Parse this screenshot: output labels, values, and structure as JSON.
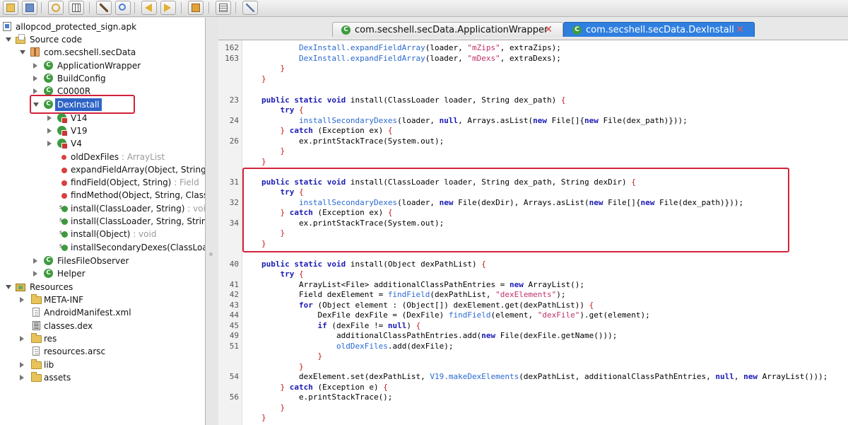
{
  "toolbar": {
    "buttons": [
      "open-icon",
      "save-all-icon",
      "sync-icon",
      "unflatten-icon",
      "wand-icon",
      "search-icon",
      "back-icon",
      "forward-icon",
      "bookmark-icon",
      "log-icon",
      "preferences-icon"
    ]
  },
  "tree": {
    "apk": "allopcod_protected_sign.apk",
    "source_code": "Source code",
    "package": "com.secshell.secData",
    "classes": [
      "ApplicationWrapper",
      "BuildConfig",
      "C0000R"
    ],
    "selected_class": "DexInstall",
    "inner": [
      "V14",
      "V19",
      "V4"
    ],
    "fields": [
      {
        "name": "oldDexFiles",
        "type": " : ArrayList"
      }
    ],
    "methods": [
      {
        "name": "expandFieldArray(Object, String, O",
        "type": ""
      },
      {
        "name": "findField(Object, String)",
        "type": " : Field"
      },
      {
        "name": "findMethod(Object, String, Class[])",
        "type": ""
      },
      {
        "name": "install(ClassLoader, String)",
        "type": " : void"
      },
      {
        "name": "install(ClassLoader, String, String)",
        "type": ""
      },
      {
        "name": "install(Object)",
        "type": " : void"
      },
      {
        "name": "installSecondaryDexes(ClassLoade",
        "type": ""
      }
    ],
    "more_classes": [
      "FilesFileObserver",
      "Helper"
    ],
    "resources": "Resources",
    "resource_items": [
      "META-INF",
      "AndroidManifest.xml",
      "classes.dex",
      "res",
      "resources.arsc",
      "lib",
      "assets"
    ]
  },
  "tabs": [
    {
      "label": "com.secshell.secData.ApplicationWrapper",
      "active": false
    },
    {
      "label": "com.secshell.secData.DexInstall",
      "active": true
    }
  ],
  "code": {
    "lines": [
      {
        "n": "162",
        "t": "        <m>DexInstall.expandFieldArray</m>(loader, <s>\"mZips\"</s>, extraZips);"
      },
      {
        "n": "163",
        "t": "        <m>DexInstall.expandFieldArray</m>(loader, <s>\"mDexs\"</s>, extraDexs);"
      },
      {
        "n": "",
        "t": "    <b>}</b>"
      },
      {
        "n": "",
        "t": "<b>}</b>"
      },
      {
        "n": "",
        "t": ""
      },
      {
        "n": "23",
        "t": "<k>public static void</k> install(ClassLoader loader, String dex_path) <b>{</b>"
      },
      {
        "n": "",
        "t": "    <k>try</k> <b>{</b>"
      },
      {
        "n": "24",
        "t": "        <m>installSecondaryDexes</m>(loader, <k>null</k>, Arrays.asList(<k>new</k> File[]{<k>new</k> File(dex_path)}));"
      },
      {
        "n": "",
        "t": "    <b>}</b> <k>catch</k> (Exception ex) <b>{</b>"
      },
      {
        "n": "26",
        "t": "        ex.printStackTrace(System.out);"
      },
      {
        "n": "",
        "t": "    <b>}</b>"
      },
      {
        "n": "",
        "t": "<b>}</b>"
      },
      {
        "n": "",
        "t": ""
      },
      {
        "n": "31",
        "t": "<k>public static void</k> install(ClassLoader loader, String dex_path, String dexDir) <b>{</b>"
      },
      {
        "n": "",
        "t": "    <k>try</k> <b>{</b>"
      },
      {
        "n": "32",
        "t": "        <m>installSecondaryDexes</m>(loader, <k>new</k> File(dexDir), Arrays.asList(<k>new</k> File[]{<k>new</k> File(dex_path)}));"
      },
      {
        "n": "",
        "t": "    <b>}</b> <k>catch</k> (Exception ex) <b>{</b>"
      },
      {
        "n": "34",
        "t": "        ex.printStackTrace(System.out);"
      },
      {
        "n": "",
        "t": "    <b>}</b>"
      },
      {
        "n": "",
        "t": "<b>}</b>"
      },
      {
        "n": "",
        "t": ""
      },
      {
        "n": "40",
        "t": "<k>public static void</k> install(Object dexPathList) <b>{</b>"
      },
      {
        "n": "",
        "t": "    <k>try</k> <b>{</b>"
      },
      {
        "n": "41",
        "t": "        ArrayList&lt;File&gt; additionalClassPathEntries = <k>new</k> ArrayList();"
      },
      {
        "n": "42",
        "t": "        Field dexElement = <m>findField</m>(dexPathList, <s>\"dexElements\"</s>);"
      },
      {
        "n": "43",
        "t": "        <k>for</k> (Object element : (Object[]) dexElement.get(dexPathList)) <b>{</b>"
      },
      {
        "n": "44",
        "t": "            DexFile dexFile = (DexFile) <m>findField</m>(element, <s>\"dexFile\"</s>).get(element);"
      },
      {
        "n": "45",
        "t": "            <k>if</k> (dexFile != <k>null</k>) <b>{</b>"
      },
      {
        "n": "49",
        "t": "                additionalClassPathEntries.add(<k>new</k> File(dexFile.getName()));"
      },
      {
        "n": "51",
        "t": "                <m>oldDexFiles</m>.add(dexFile);"
      },
      {
        "n": "",
        "t": "            <b>}</b>"
      },
      {
        "n": "",
        "t": "        <b>}</b>"
      },
      {
        "n": "54",
        "t": "        dexElement.set(dexPathList, <m>V19.makeDexElements</m>(dexPathList, additionalClassPathEntries, <k>null</k>, <k>new</k> ArrayList()));"
      },
      {
        "n": "",
        "t": "    <b>}</b> <k>catch</k> (Exception e) <b>{</b>"
      },
      {
        "n": "56",
        "t": "        e.printStackTrace();"
      },
      {
        "n": "",
        "t": "    <b>}</b>"
      },
      {
        "n": "",
        "t": "<b>}</b>"
      }
    ]
  }
}
